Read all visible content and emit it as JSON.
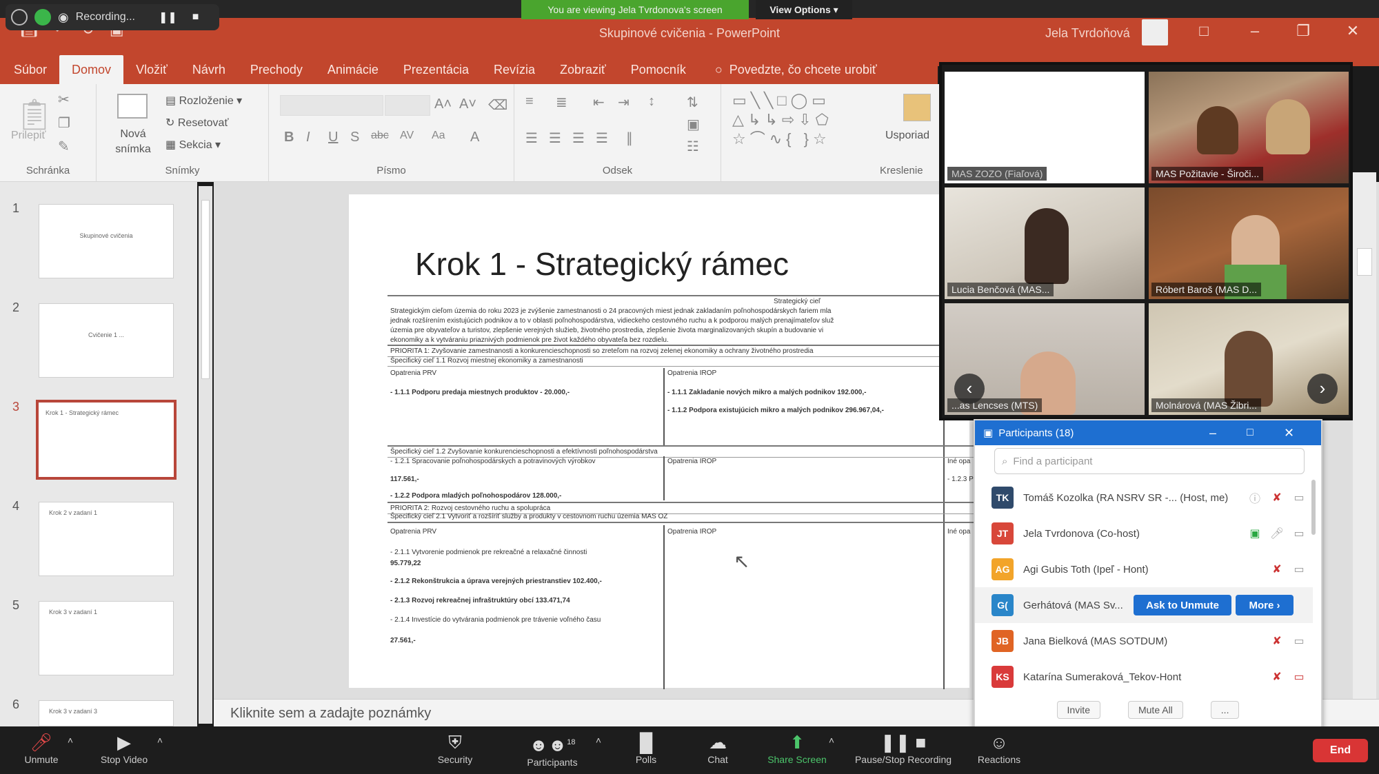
{
  "recording": {
    "label": "Recording..."
  },
  "share_banner": {
    "text": "You are viewing Jela Tvrdonova's screen",
    "view_options": "View Options ▾"
  },
  "app": {
    "title": "Skupinové cvičenia - PowerPoint",
    "user": "Jela Tvrdoňová"
  },
  "ribbon_tabs": [
    "Súbor",
    "Domov",
    "Vložiť",
    "Návrh",
    "Prechody",
    "Animácie",
    "Prezentácia",
    "Revízia",
    "Zobraziť",
    "Pomocník"
  ],
  "tell_me": "Povedzte, čo chcete urobiť",
  "ribbon": {
    "clipboard": {
      "paste": "Prilepiť",
      "label": "Schránka"
    },
    "slides": {
      "new_slide": "Nová snímka",
      "layout": "Rozloženie",
      "reset": "Resetovať",
      "section": "Sekcia",
      "label": "Snímky"
    },
    "font": {
      "label": "Písmo"
    },
    "paragraph": {
      "label": "Odsek"
    },
    "drawing": {
      "arrange": "Usporiad",
      "label": "Kreslenie"
    }
  },
  "slides_pane": [
    {
      "num": "1",
      "text": "Skupinové cvičenia"
    },
    {
      "num": "2",
      "text": "Cvičenie 1 ..."
    },
    {
      "num": "3",
      "text": "Krok 1 - Strategický rámec"
    },
    {
      "num": "4",
      "text": "Krok 2 v zadaní 1"
    },
    {
      "num": "5",
      "text": "Krok 3 v zadaní 1"
    },
    {
      "num": "6",
      "text": "Krok 3 v zadaní 3"
    }
  ],
  "slide": {
    "title": "Krok 1 - Strategický rámec",
    "table_header": "Strategický cieľ",
    "intro": [
      "Strategickým cieľom územia do roku 2023 je zvýšenie zamestnanosti o 24 pracovných miest jednak zakladaním poľnohospodárskych fariem mla",
      "jednak rozšírením existujúcich podnikov a to v oblasti poľnohospodárstva, vidieckeho cestovného ruchu a k podporou malých prenajímateľov služ",
      "územia pre obyvateľov a turistov, zlepšenie verejných služieb, životného prostredia, zlepšenie života marginalizovaných skupín a budovanie vi",
      "ekonomiky a k vytváraniu priaznivých podmienok pre život každého obyvateľa bez rozdielu."
    ],
    "priority1": "PRIORITA 1: Zvyšovanie zamestnanosti a konkurencieschopnosti so zreteľom na rozvoj zelenej ekonomiky a ochrany životného prostredia",
    "goal11": "Špecifický cieľ 1.1 Rozvoj miestnej ekonomiky a zamestnanosti",
    "col_prv": "Opatrenia PRV",
    "col_irop": "Opatrenia IROP",
    "col_ine": "Iné opa",
    "m111": "- 1.1.1 Podporu predaja miestnych produktov - 20.000,-",
    "i111": "- 1.1.1 Zakladanie nových mikro a malých podnikov 192.000,-",
    "i112": "- 1.1.2 Podpora existujúcich mikro a malých podnikov 296.967,04,-",
    "goal12": "Špecifický cieľ 1.2 Zvyšovanie konkurencieschopnosti a efektívnosti poľnohospodárstva",
    "m121": "- 1.2.1 Spracovanie poľnohospodárskych a potravinových výrobkov",
    "m121v": "117.561,-",
    "m122": "- 1.2.2 Podpora mladých poľnohospodárov 128.000,-",
    "ine123": "- 1.2.3 P",
    "priority2": "PRIORITA 2: Rozvoj cestovného ruchu a spolupráca",
    "goal21": "Špecifický cieľ 2.1 Vytvoriť a rozšíriť služby a produkty v cestovnom ruchu územia MAS OZ",
    "m211": "- 2.1.1 Vytvorenie podmienok pre rekreačné a relaxačné činnosti",
    "m211v": "95.779,22",
    "m212": "- 2.1.2 Rekonštrukcia a úprava verejných priestranstiev 102.400,-",
    "m213": "- 2.1.3 Rozvoj rekreačnej infraštruktúry obcí 133.471,74",
    "m214": "- 2.1.4 Investície do vytvárania podmienok pre trávenie voľného času",
    "m214v": "27.561,-"
  },
  "notes_placeholder": "Kliknite sem a zadajte poznámky",
  "video_tiles": [
    {
      "label": "MAS ZOZO (Fiaľová)"
    },
    {
      "label": "MAS Požitavie - Široči..."
    },
    {
      "label": "Lucia Benčová (MAS..."
    },
    {
      "label": "Róbert Baroš (MAS D..."
    },
    {
      "label": "...as Lencses (MTS)"
    },
    {
      "label": "Molnárová (MAS Žibri..."
    }
  ],
  "participants": {
    "title": "Participants (18)",
    "search_placeholder": "Find a participant",
    "list": [
      {
        "initials": "TK",
        "name": "Tomáš Kozolka (RA NSRV SR -... (Host, me)",
        "color": "#2f4a6b"
      },
      {
        "initials": "JT",
        "name": "Jela Tvrdonova (Co-host)",
        "color": "#d8473a"
      },
      {
        "initials": "AG",
        "name": "Agi Gubis Toth (Ipeľ - Hont)",
        "color": "#f2a42a"
      },
      {
        "initials": "G(",
        "name": "Gerhátová (MAS Sv...",
        "color": "#2a86c9"
      },
      {
        "initials": "JB",
        "name": "Jana Bielková (MAS SOTDUM)",
        "color": "#e06424"
      },
      {
        "initials": "KS",
        "name": "Katarína Sumeraková_Tekov-Hont",
        "color": "#d93a3a"
      }
    ],
    "ask_unmute": "Ask to Unmute",
    "more": "More ›",
    "invite": "Invite",
    "mute_all": "Mute All",
    "dots": "..."
  },
  "toolbar": {
    "unmute": "Unmute",
    "stop_video": "Stop Video",
    "security": "Security",
    "participants": "Participants",
    "participants_count": "18",
    "polls": "Polls",
    "chat": "Chat",
    "share_screen": "Share Screen",
    "pause_recording": "Pause/Stop Recording",
    "reactions": "Reactions",
    "end": "End"
  }
}
